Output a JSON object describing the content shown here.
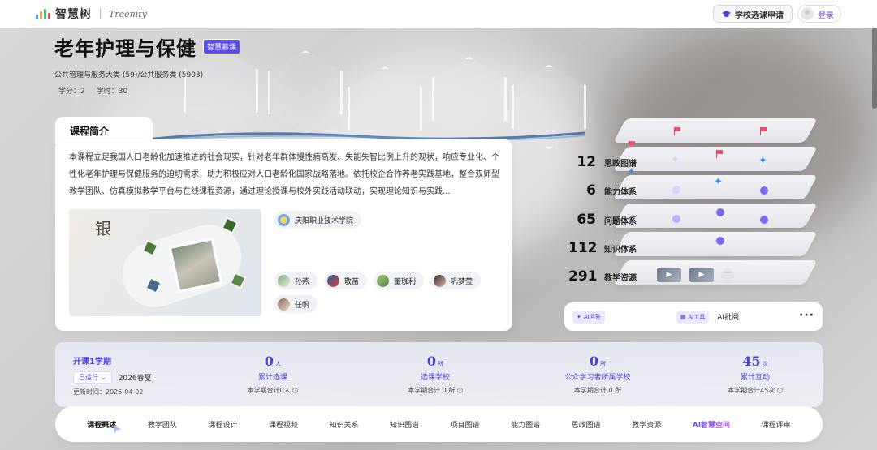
{
  "app": {
    "logo_cn": "智慧树",
    "logo_en": "Treenity",
    "apply_label": "学校选课申请",
    "login_label": "登录"
  },
  "course": {
    "title": "老年护理与保健",
    "tag": "智慧慕课",
    "category": "公共管理与服务大类 (59)/公共服务类 (5903)",
    "credit": "学分：2",
    "hours": "学时：30"
  },
  "intro": {
    "heading": "课程简介",
    "text": "本课程立足我国人口老龄化加速推进的社会现实，针对老年群体慢性病高发、失能失智比例上升的现状，响应专业化、个性化老年护理与保健服务的迫切需求，助力积极应对人口老龄化国家战略落地。依托校企合作养老实践基地，整合双师型教学团队、仿真模拟教学平台与在线课程资源，通过理论授课与校外实践活动联动，实现理论知识与实践...",
    "cover_char": "银",
    "school": "庆阳职业技术学院",
    "teachers": [
      "孙燕",
      "敬苗",
      "董珈利",
      "巩梦莹",
      "任帆"
    ]
  },
  "layers": [
    {
      "num": "12",
      "label": "思政图谱"
    },
    {
      "num": "6",
      "label": "能力体系"
    },
    {
      "num": "65",
      "label": "问题体系"
    },
    {
      "num": "112",
      "label": "知识体系"
    },
    {
      "num": "291",
      "label": "教学资源"
    }
  ],
  "ai": {
    "chip1": "AI问答",
    "chip2": "AI工具",
    "text": "AI批阅",
    "more": "···"
  },
  "term": {
    "title": "开课1学期",
    "status": "已运行",
    "season": "2026春夏",
    "updated": "更新时间：2026-04-02"
  },
  "metrics": [
    {
      "num": "0",
      "unit": "人",
      "label": "累计选课",
      "sub": "本学期合计0人"
    },
    {
      "num": "0",
      "unit": "所",
      "label": "选课学校",
      "sub": "本学期合计 0 所"
    },
    {
      "num": "0",
      "unit": "所",
      "label": "公众学习者所属学校",
      "sub": "本学期合计 0 所"
    },
    {
      "num": "45",
      "unit": "次",
      "label": "累计互动",
      "sub": "本学期合计45次"
    }
  ],
  "tabs": [
    "课程概述",
    "教学团队",
    "课程设计",
    "课程视频",
    "知识关系",
    "知识图谱",
    "项目图谱",
    "能力图谱",
    "思政图谱",
    "教学资源",
    "AI智慧空间",
    "课程评审"
  ],
  "colors": {
    "accent": "#4b3fd8",
    "tag_bg": "#5b4de8",
    "flag": "#f0506a",
    "node": "#7a6cf0"
  }
}
